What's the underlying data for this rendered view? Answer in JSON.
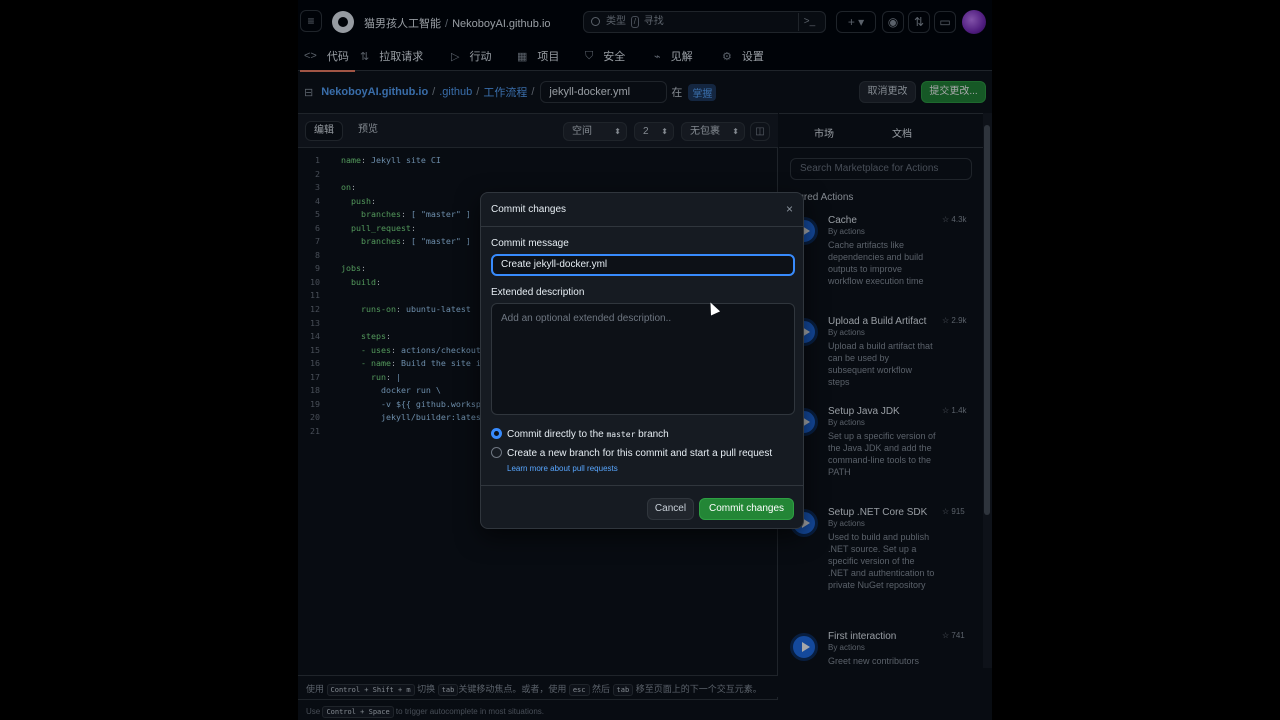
{
  "header": {
    "owner": "猫男孩人工智能",
    "repo": "NekoboyAI.github.io",
    "search_placeholder_prefix": "类型",
    "search_key": "/",
    "search_placeholder_suffix": "寻找",
    "command_glyph": ">_",
    "plus_label": "+ ▾"
  },
  "repo_tabs": [
    {
      "label": "代码",
      "icon": "code-icon"
    },
    {
      "label": "拉取请求",
      "icon": "pull-request-icon"
    },
    {
      "label": "行动",
      "icon": "play-icon"
    },
    {
      "label": "项目",
      "icon": "table-icon"
    },
    {
      "label": "安全",
      "icon": "shield-icon"
    },
    {
      "label": "见解",
      "icon": "graph-icon"
    },
    {
      "label": "设置",
      "icon": "gear-icon"
    }
  ],
  "path": {
    "repo": "NekoboyAI.github.io",
    "dir1": ".github",
    "dir2": "工作流程",
    "filename": "jekyll-docker.yml",
    "in_label": "在",
    "branch": "掌握"
  },
  "actions": {
    "cancel": "取消更改",
    "commit": "提交更改..."
  },
  "editor": {
    "tab_edit": "编辑",
    "tab_preview": "预览",
    "indent_mode": "空间",
    "indent_size": "2",
    "wrap_mode": "无包裹",
    "lines": [
      {
        "n": "1",
        "key": "name",
        "rest": " Jekyll site CI"
      },
      {
        "n": "2",
        "key": "",
        "rest": ""
      },
      {
        "n": "3",
        "key": "on",
        "rest": ""
      },
      {
        "n": "4",
        "key": "  push",
        "rest": ""
      },
      {
        "n": "5",
        "key": "    branches",
        "rest": " [ \"master\" ]"
      },
      {
        "n": "6",
        "key": "  pull_request",
        "rest": ""
      },
      {
        "n": "7",
        "key": "    branches",
        "rest": " [ \"master\" ]"
      },
      {
        "n": "8",
        "key": "",
        "rest": ""
      },
      {
        "n": "9",
        "key": "jobs",
        "rest": ""
      },
      {
        "n": "10",
        "key": "  build",
        "rest": ""
      },
      {
        "n": "11",
        "key": "",
        "rest": ""
      },
      {
        "n": "12",
        "key": "    runs-on",
        "rest": " ubuntu-latest"
      },
      {
        "n": "13",
        "key": "",
        "rest": ""
      },
      {
        "n": "14",
        "key": "    steps",
        "rest": ""
      },
      {
        "n": "15",
        "key": "    - uses",
        "rest": " actions/checkout@v"
      },
      {
        "n": "16",
        "key": "    - name",
        "rest": " Build the site in t"
      },
      {
        "n": "17",
        "key": "      run",
        "rest": " |"
      },
      {
        "n": "18",
        "key": "",
        "rest": "        docker run \\"
      },
      {
        "n": "19",
        "key": "",
        "rest": "        -v ${{ github.workspace"
      },
      {
        "n": "20",
        "key": "",
        "rest": "        jekyll/builder:latest /"
      },
      {
        "n": "21",
        "key": "",
        "rest": ""
      }
    ],
    "footer1": [
      "使用",
      "Control + Shift + m",
      "切换",
      "tab",
      "关键移动焦点。或者，使用",
      "esc",
      "然后",
      "tab",
      "移至页面上的下一个交互元素。"
    ],
    "footer2": [
      "Use",
      "Control + Space",
      "to trigger autocomplete in most situations."
    ]
  },
  "marketplace": {
    "tab_market": "市场",
    "tab_docs": "文档",
    "search_placeholder": "Search Marketplace for Actions",
    "featured": "atured Actions",
    "items": [
      {
        "name": "Cache",
        "by": "By actions",
        "stars": "☆ 4.3k",
        "desc": "Cache artifacts like dependencies and build outputs to improve workflow execution time"
      },
      {
        "name": "Upload a Build Artifact",
        "by": "By actions",
        "stars": "☆ 2.9k",
        "desc": "Upload a build artifact that can be used by subsequent workflow steps"
      },
      {
        "name": "Setup Java JDK",
        "by": "By actions",
        "stars": "☆ 1.4k",
        "desc": "Set up a specific version of the Java JDK and add the command-line tools to the PATH"
      },
      {
        "name": "Setup .NET Core SDK",
        "by": "By actions",
        "stars": "☆ 915",
        "desc": "Used to build and publish .NET source. Set up a specific version of the .NET and authentication to private NuGet repository"
      },
      {
        "name": "First interaction",
        "by": "By actions",
        "stars": "☆ 741",
        "desc": "Greet new contributors"
      }
    ]
  },
  "modal": {
    "title": "Commit changes",
    "close": "×",
    "message_label": "Commit message",
    "message_value": "Create jekyll-docker.yml",
    "desc_label": "Extended description",
    "desc_placeholder": "Add an optional extended description..",
    "radio1_a": "Commit directly to the",
    "radio1_branch": "master",
    "radio1_b": "branch",
    "radio2": "Create a new branch for this commit and start a pull request",
    "learn_more": "Learn more about pull requests",
    "cancel": "Cancel",
    "commit": "Commit changes"
  }
}
